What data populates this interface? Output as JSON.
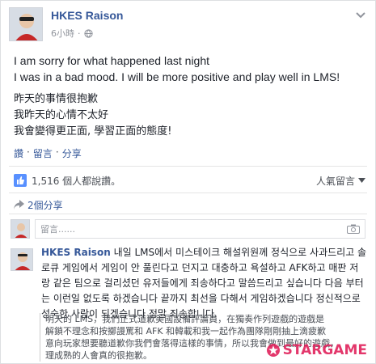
{
  "post": {
    "author": "HKES Raison",
    "time": "6小時",
    "body_en": [
      "I am sorry for what happened last night",
      "I was in a bad mood. I will be more positive and play well in LMS!"
    ],
    "body_cn": [
      "昨天的事情很抱歉",
      "我昨天的心情不太好",
      "我會變得更正面, 學習正面的態度!"
    ],
    "actions": {
      "like": "讚",
      "comment": "留言",
      "share": "分享"
    }
  },
  "reactions": {
    "likes": "1,516 個人都說讚。",
    "sort": "人氣留言"
  },
  "shares": {
    "label": "2個分享"
  },
  "comment_box": {
    "placeholder": "留言......"
  },
  "comment": {
    "author": "HKES Raison",
    "text_kr": "내일 LMS에서 미스테이크 해설위원께 정식으로 사과드리고 솔로큐 게임에서 게임이 안 풀린다고 던지고 대충하고 욕설하고 AFK하고 매판 저랑 같은 팀으로 걸리셨던 유저들에게 죄송하다고 말씀드리고 싶습니다 다음 부터는 이런일 없도록 하겠습니다 끝까지 최선을 다해서 게임하겠습니다 정신적으로 성숙한 사람이 되겠습니다 정말 죄송합니다.",
    "quote": [
      "明天的 LMS，我們正式道歉美國設備評論員，在獨奏作列遊戲的遊戲是",
      "解鎖不理念和按擲謾罵和 AFK 和韓載和我一起作為團隊剛剛抽上滴疲歉",
      "意向玩家想要聽道歉你我們會落得這樣的事情，所以我會做到最好的遊戲，",
      "理成熟的人會真的很抱歉。"
    ]
  },
  "watermark": "STARGAME"
}
